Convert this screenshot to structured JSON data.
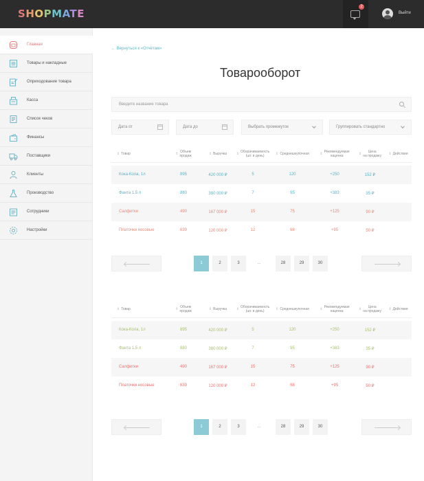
{
  "app": {
    "logo_letters": [
      "S",
      "H",
      "O",
      "P",
      "M",
      "A",
      "T",
      "E"
    ],
    "messages_count": "2",
    "logout_label": "Выйти"
  },
  "sidebar": {
    "items": [
      {
        "label": "Главная",
        "icon": "home-icon",
        "active": true
      },
      {
        "label": "Товары и накладные",
        "icon": "list-icon"
      },
      {
        "label": "Оприходование товара",
        "icon": "edit-doc-icon"
      },
      {
        "label": "Касса",
        "icon": "register-icon"
      },
      {
        "label": "Список чеков",
        "icon": "receipts-icon"
      },
      {
        "label": "Финансы",
        "icon": "wallet-icon"
      },
      {
        "label": "Поставщики",
        "icon": "truck-icon"
      },
      {
        "label": "Клиенты",
        "icon": "user-icon"
      },
      {
        "label": "Производство",
        "icon": "flask-icon"
      },
      {
        "label": "Сотрудники",
        "icon": "staff-icon"
      },
      {
        "label": "Настройки",
        "icon": "gear-icon"
      }
    ]
  },
  "main": {
    "back_link": "←  Вернуться к «Отчётам»",
    "title": "Товарооборот",
    "search_placeholder": "Введите название товара",
    "filters": {
      "date_from": "Дата от",
      "date_to": "Дата до",
      "interval": "Выбрать промежуток",
      "grouping": "Группировать стандартно"
    },
    "columns": [
      {
        "label": "Товар",
        "sort": true
      },
      {
        "label": "Объем\nпродаж",
        "sort": true
      },
      {
        "label": "Выручка",
        "sort": true
      },
      {
        "label": "Оборачиваемость\n(шт. в день)",
        "sort": true
      },
      {
        "label": "Среднешкупочная",
        "sort": true
      },
      {
        "label": "Рекомендуемая\nнаценка",
        "sort": true
      },
      {
        "label": "Цена\nна продажу",
        "sort": true
      },
      {
        "label": "Действия",
        "sort": true
      }
    ],
    "tables": [
      {
        "rows": [
          {
            "cells": [
              "Кока-Кола, 1л",
              "895",
              "420 000 ₽",
              "5",
              "120",
              "+250",
              "152 ₽"
            ],
            "color": "#5bb2c8"
          },
          {
            "cells": [
              "Фанта 1.5 л",
              "880",
              "380 000 ₽",
              "7",
              "95",
              "+383",
              "35 ₽"
            ],
            "color": "#5bb2c8"
          },
          {
            "cells": [
              "Салфетки",
              "490",
              "167 000 ₽",
              "15",
              "75",
              "+125",
              "90 ₽"
            ],
            "color": "#e58a7a"
          },
          {
            "cells": [
              "Платочки носовые",
              "639",
              "120 000 ₽",
              "12",
              "68",
              "+95",
              "50 ₽"
            ],
            "color": "#e58a7a"
          }
        ],
        "pages": [
          "1",
          "2",
          "3",
          "...",
          "28",
          "29",
          "30"
        ]
      },
      {
        "rows": [
          {
            "cells": [
              "Кока-Кола, 1л",
              "895",
              "420 000 ₽",
              "5",
              "120",
              "+250",
              "152 ₽"
            ],
            "color": "#a8bf6b"
          },
          {
            "cells": [
              "Фанта 1.5 л",
              "880",
              "380 000 ₽",
              "7",
              "95",
              "+383",
              "35 ₽"
            ],
            "color": "#a8bf6b"
          },
          {
            "cells": [
              "Салфетки",
              "490",
              "167 000 ₽",
              "15",
              "75",
              "+125",
              "90 ₽"
            ],
            "color": "#f07070"
          },
          {
            "cells": [
              "Платочки носовые",
              "639",
              "120 000 ₽",
              "12",
              "68",
              "+95",
              "50 ₽"
            ],
            "color": "#f07070"
          }
        ],
        "pages": [
          "1",
          "2",
          "3",
          "...",
          "28",
          "29",
          "30"
        ]
      }
    ]
  }
}
